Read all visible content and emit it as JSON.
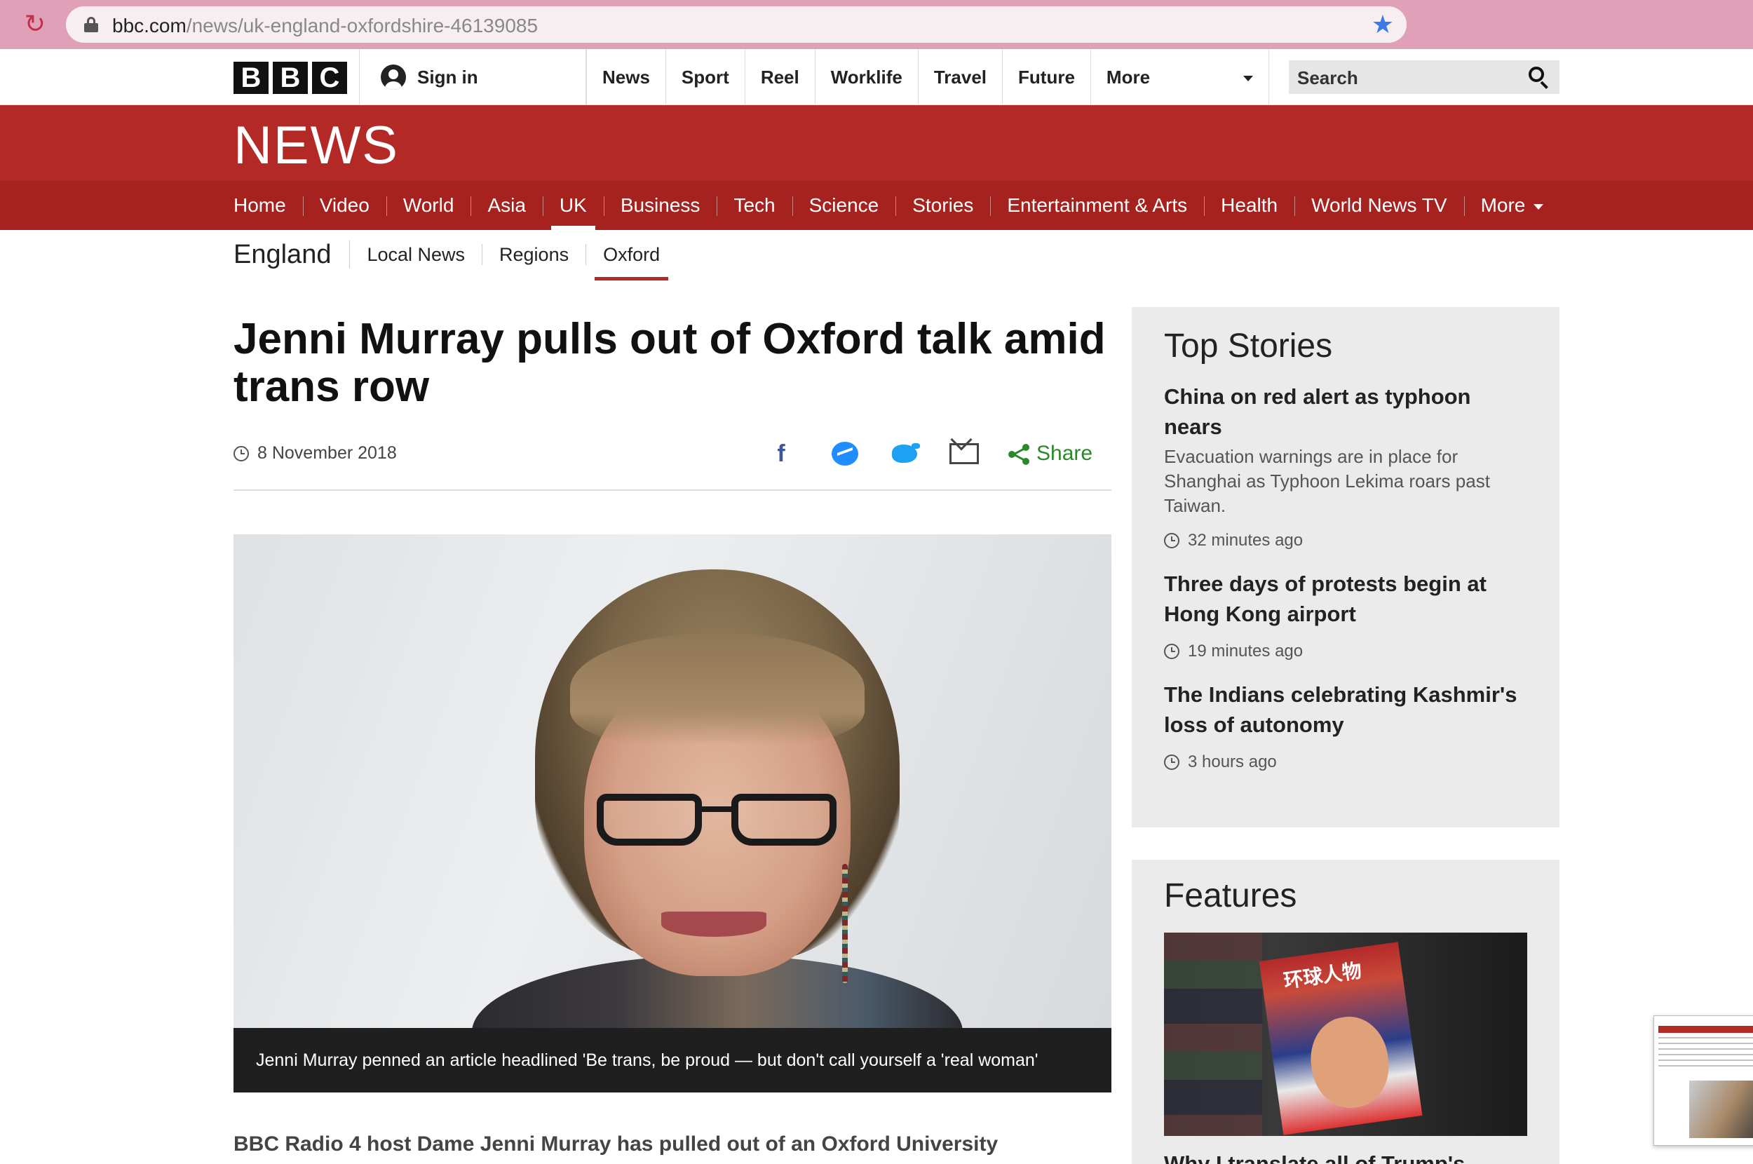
{
  "browser": {
    "url_host": "bbc.com",
    "url_path": "/news/uk-england-oxfordshire-46139085"
  },
  "bbc_bar": {
    "logo_letters": [
      "B",
      "B",
      "C"
    ],
    "sign_in": "Sign in",
    "nav": [
      "News",
      "Sport",
      "Reel",
      "Worklife",
      "Travel",
      "Future"
    ],
    "more": "More",
    "search_label": "Search"
  },
  "news": {
    "logo": "NEWS",
    "nav": [
      {
        "label": "Home",
        "active": false
      },
      {
        "label": "Video",
        "active": false
      },
      {
        "label": "World",
        "active": false
      },
      {
        "label": "Asia",
        "active": false
      },
      {
        "label": "UK",
        "active": true
      },
      {
        "label": "Business",
        "active": false
      },
      {
        "label": "Tech",
        "active": false
      },
      {
        "label": "Science",
        "active": false
      },
      {
        "label": "Stories",
        "active": false
      },
      {
        "label": "Entertainment & Arts",
        "active": false
      },
      {
        "label": "Health",
        "active": false
      },
      {
        "label": "World News TV",
        "active": false
      }
    ],
    "nav_more": "More"
  },
  "subnav": {
    "region": "England",
    "items": [
      {
        "label": "Local News",
        "active": false
      },
      {
        "label": "Regions",
        "active": false
      },
      {
        "label": "Oxford",
        "active": true
      }
    ]
  },
  "article": {
    "headline": "Jenni Murray pulls out of Oxford talk amid trans row",
    "date": "8 November 2018",
    "share_label": "Share",
    "caption": "Jenni Murray penned an article headlined 'Be trans, be proud — but don't call yourself a 'real woman'",
    "intro": "BBC Radio 4 host Dame Jenni Murray has pulled out of an Oxford University"
  },
  "top_stories": {
    "title": "Top Stories",
    "items": [
      {
        "title": "China on red alert as typhoon nears",
        "summary": "Evacuation warnings are in place for Shanghai as Typhoon Lekima roars past Taiwan.",
        "time": "32 minutes ago"
      },
      {
        "title": "Three days of protests begin at Hong Kong airport",
        "summary": "",
        "time": "19 minutes ago"
      },
      {
        "title": "The Indians celebrating Kashmir's loss of autonomy",
        "summary": "",
        "time": "3 hours ago"
      }
    ]
  },
  "features": {
    "title": "Features",
    "headline": "Why I translate all of Trump's",
    "image_text": "环球人物"
  },
  "colors": {
    "bbc_red": "#b32925",
    "nav_red": "#a5221f",
    "share_green": "#2a8a2a",
    "facebook": "#3b5998",
    "twitter": "#1da1f2",
    "messenger": "#1f8cff",
    "bookmark_star": "#3b7be8"
  },
  "icons": [
    "reload-icon",
    "lock-icon",
    "star-icon",
    "user-icon",
    "search-icon",
    "clock-icon",
    "facebook-icon",
    "messenger-icon",
    "twitter-icon",
    "email-icon",
    "share-icon"
  ]
}
